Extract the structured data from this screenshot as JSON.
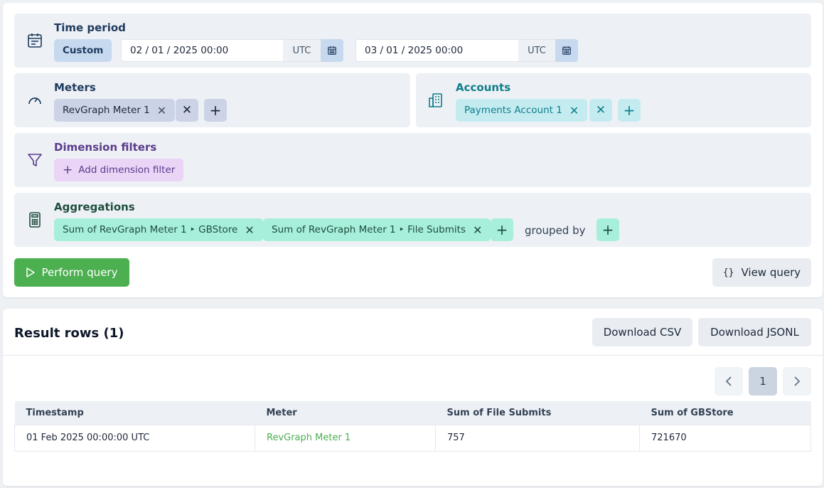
{
  "time_period": {
    "title": "Time period",
    "custom_label": "Custom",
    "start_value": "02 / 01 / 2025 00:00",
    "end_value": "03 / 01 / 2025 00:00",
    "tz_label": "UTC"
  },
  "meters": {
    "title": "Meters",
    "chips": [
      {
        "label": "RevGraph Meter 1"
      }
    ]
  },
  "accounts": {
    "title": "Accounts",
    "chips": [
      {
        "label": "Payments Account 1"
      }
    ]
  },
  "dimension_filters": {
    "title": "Dimension filters",
    "add_label": "Add dimension filter"
  },
  "aggregations": {
    "title": "Aggregations",
    "chips": [
      {
        "label": "Sum of RevGraph Meter 1 ‣ GBStore"
      },
      {
        "label": "Sum of RevGraph Meter 1 ‣ File Submits"
      }
    ],
    "grouped_by_label": "grouped by"
  },
  "actions": {
    "perform_query": "Perform query",
    "view_query": "View query",
    "braces": "{}"
  },
  "results": {
    "title": "Result rows (1)",
    "download_csv": "Download CSV",
    "download_jsonl": "Download JSONL",
    "page_number": "1",
    "columns": [
      "Timestamp",
      "Meter",
      "Sum of File Submits",
      "Sum of GBStore"
    ],
    "rows": [
      {
        "timestamp": "01 Feb 2025 00:00:00 UTC",
        "meter": "RevGraph Meter 1",
        "file_submits": "757",
        "gbstore": "721670"
      }
    ]
  },
  "colors": {
    "primary_green": "#4caf50",
    "meter_chip": "#ccd3e6",
    "account_chip": "#c4ecf0",
    "filter_chip": "#ead5f7",
    "agg_chip": "#a7efdb",
    "accounts_title": "#0e7d8c",
    "filters_title": "#5b3b8c"
  }
}
